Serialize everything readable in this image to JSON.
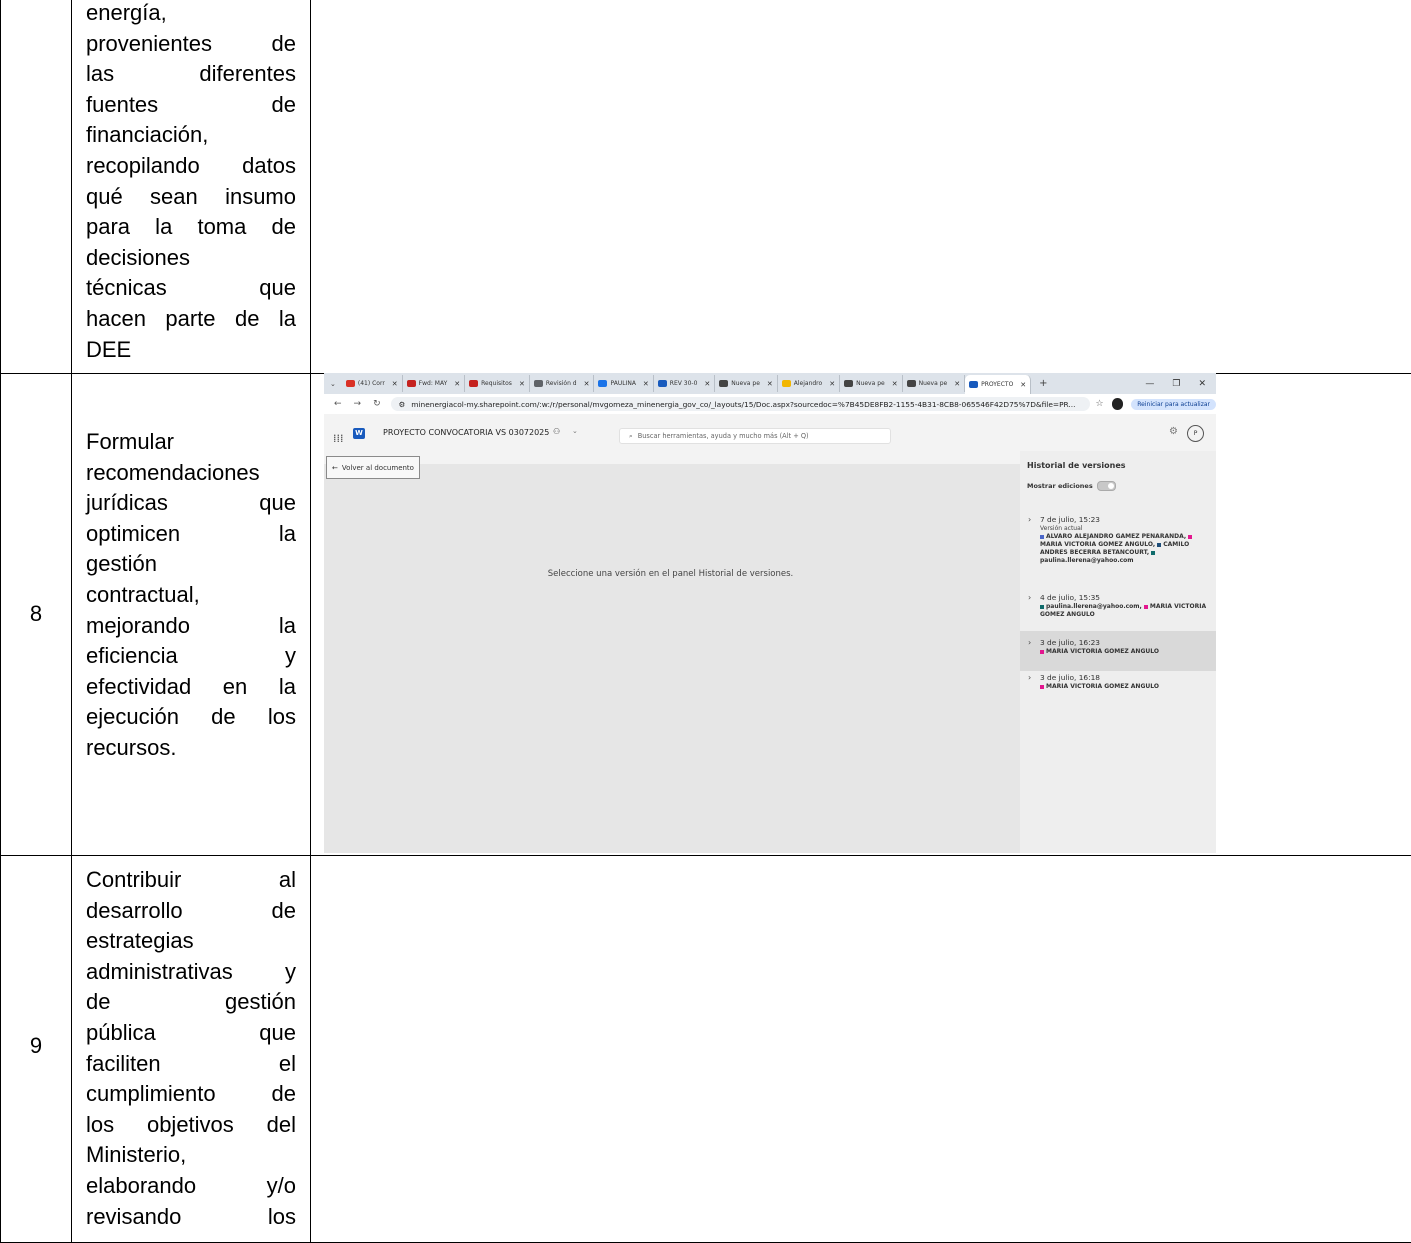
{
  "rows": [
    {
      "number": "",
      "lines": [
        "energía,",
        "provenientes de",
        "las diferentes",
        "fuentes de",
        "financiación,",
        "recopilando datos",
        "qué sean insumo",
        "para la toma de",
        "decisiones",
        "técnicas que",
        "hacen parte de la",
        "DEE"
      ]
    },
    {
      "number": "8",
      "lines": [
        "Formular",
        "recomendaciones",
        "jurídicas que",
        "optimicen la",
        "gestión",
        "contractual,",
        "mejorando la",
        "eficiencia y",
        "efectividad en la",
        "ejecución de los",
        "recursos."
      ]
    },
    {
      "number": "9",
      "lines": [
        "Contribuir al",
        "desarrollo de",
        "estrategias",
        "administrativas y",
        "de gestión",
        "pública que",
        "faciliten el",
        "cumplimiento de",
        "los objetivos del",
        "Ministerio,",
        "elaborando y/o",
        "revisando los"
      ]
    }
  ],
  "screenshot": {
    "tabs": [
      {
        "label": "(41) Corr",
        "color": "#d93025"
      },
      {
        "label": "Fwd: MAY",
        "color": "#c5221f"
      },
      {
        "label": "Requisitos",
        "color": "#c5221f"
      },
      {
        "label": "Revisión d",
        "color": "#5f6368"
      },
      {
        "label": "PAULINA",
        "color": "#1a73e8"
      },
      {
        "label": "REV 30-0",
        "color": "#185abd"
      },
      {
        "label": "Nueva pe",
        "color": "#444444"
      },
      {
        "label": "Alejandro",
        "color": "#f2b600"
      },
      {
        "label": "Nueva pe",
        "color": "#444444"
      },
      {
        "label": "Nueva pe",
        "color": "#444444"
      },
      {
        "label": "PROYECTO",
        "color": "#185abd"
      }
    ],
    "url": "minenergiacol-my.sharepoint.com/:w:/r/personal/mvgomeza_minenergia_gov_co/_layouts/15/Doc.aspx?sourcedoc=%7B45DE8FB2-1155-4B31-8CB8-065546F42D75%7D&file=PR...",
    "update_button": "Reiniciar para actualizar",
    "doc_title": "PROYECTO CONVOCATORIA VS 03072025",
    "search_placeholder": "Buscar herramientas, ayuda y mucho más (Alt + Q)",
    "avatar_letter": "P",
    "back_label": "Volver al documento",
    "canvas_message": "Seleccione una versión en el panel Historial de versiones.",
    "panel": {
      "title": "Historial de versiones",
      "toggle_label": "Mostrar ediciones",
      "versions": [
        {
          "date": "7 de julio, 15:23",
          "sub": "Versión actual",
          "authors": [
            {
              "name": "ALVARO ALEJANDRO GAMEZ PENARANDA,",
              "color": "#4a66c9"
            },
            {
              "name": "MARIA VICTORIA GOMEZ ANGULO,",
              "color": "#e3178f"
            },
            {
              "name": "CAMILO ANDRES BECERRA BETANCOURT,",
              "color": "#1f4e79"
            },
            {
              "name": "paulina.llerena@yahoo.com",
              "color": "#0f6b6b"
            }
          ]
        },
        {
          "date": "4 de julio, 15:35",
          "sub": "",
          "authors": [
            {
              "name": "paulina.llerena@yahoo.com,",
              "color": "#0f6b6b"
            },
            {
              "name": "MARIA VICTORIA GOMEZ ANGULO",
              "color": "#e3178f"
            }
          ]
        },
        {
          "date": "3 de julio, 16:23",
          "sub": "",
          "authors": [
            {
              "name": "MARIA VICTORIA GOMEZ ANGULO",
              "color": "#e3178f"
            }
          ]
        },
        {
          "date": "3 de julio, 16:18",
          "sub": "",
          "authors": [
            {
              "name": "MARIA VICTORIA GOMEZ ANGULO",
              "color": "#e3178f"
            }
          ]
        }
      ]
    }
  }
}
